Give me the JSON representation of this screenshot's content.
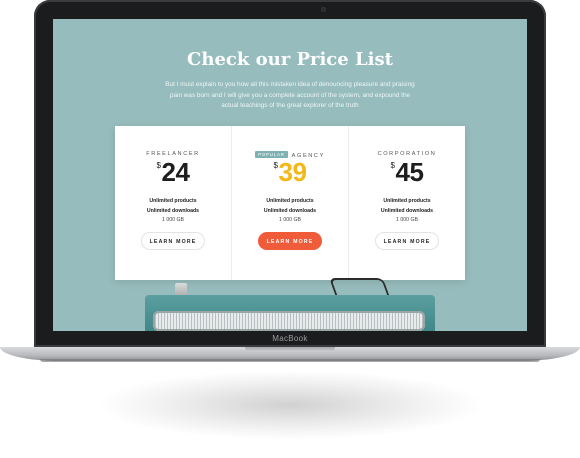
{
  "device": {
    "brand_label": "MacBook"
  },
  "page": {
    "heading": "Check our Price List",
    "subtext": "But I must explain to you how all this mistaken idea of denouncing pleasure and praising pain was born and I will give you a complete account of the system, and expound the actual teachings of the great explorer of the truth"
  },
  "plans": [
    {
      "name": "FREELANCER",
      "currency": "$",
      "price": "24",
      "feature1": "Unlimited products",
      "feature2": "Unlimited downloads",
      "storage": "1 000 GB",
      "button": "LEARN MORE"
    },
    {
      "badge": "POPULAR",
      "name": "AGENCY",
      "currency": "$",
      "price": "39",
      "feature1": "Unlimited products",
      "feature2": "Unlimited downloads",
      "storage": "1 000 GB",
      "button": "LEARN MORE"
    },
    {
      "name": "CORPORATION",
      "currency": "$",
      "price": "45",
      "feature1": "Unlimited products",
      "feature2": "Unlimited downloads",
      "storage": "1 000 GB",
      "button": "LEARN MORE"
    }
  ],
  "colors": {
    "screen_bg": "#97bcbd",
    "accent_button": "#f05b3a",
    "popular_price": "#f2b818",
    "badge_bg": "#7fb1b3"
  }
}
